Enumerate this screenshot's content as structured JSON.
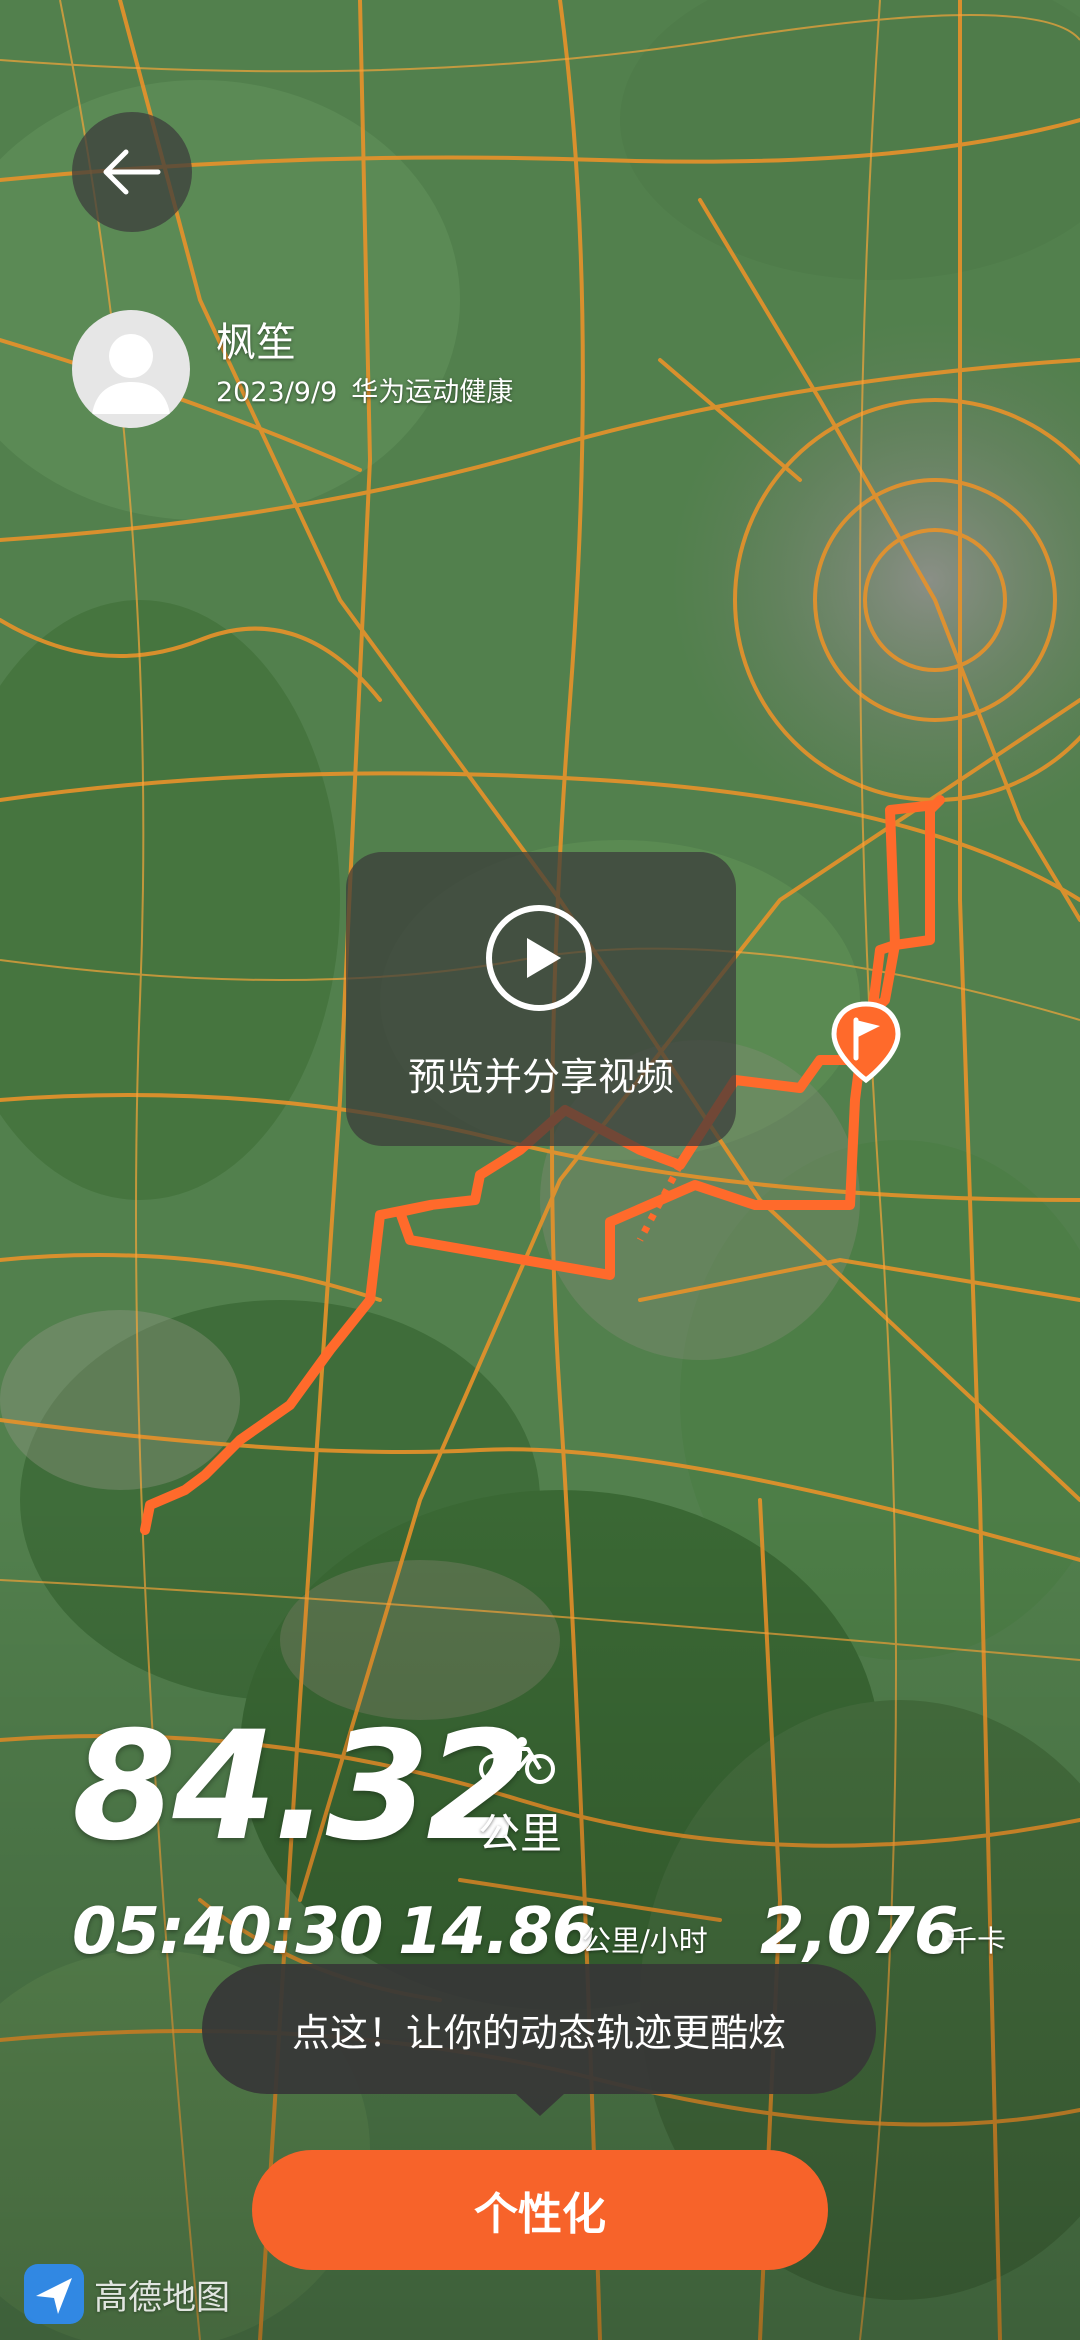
{
  "user": {
    "name": "枫笙",
    "date": "2023/9/9",
    "source": "华为运动健康"
  },
  "preview": {
    "label": "预览并分享视频"
  },
  "stats": {
    "distance": "84.32",
    "distance_unit": "公里",
    "duration": "05:40:30",
    "speed": "14.86",
    "speed_unit": "公里/小时",
    "calories": "2,076",
    "calories_unit": "千卡"
  },
  "tip": {
    "text": "点这！让你的动态轨迹更酷炫"
  },
  "cta": {
    "label": "个性化"
  },
  "map_provider": {
    "name": "高德地图"
  },
  "colors": {
    "accent": "#f7632a",
    "route": "#ff6a2b",
    "road": "#e8922a"
  },
  "icons": [
    "back-arrow-icon",
    "user-avatar-icon",
    "play-icon",
    "bicycle-icon",
    "finish-flag-icon",
    "amap-logo-icon"
  ]
}
